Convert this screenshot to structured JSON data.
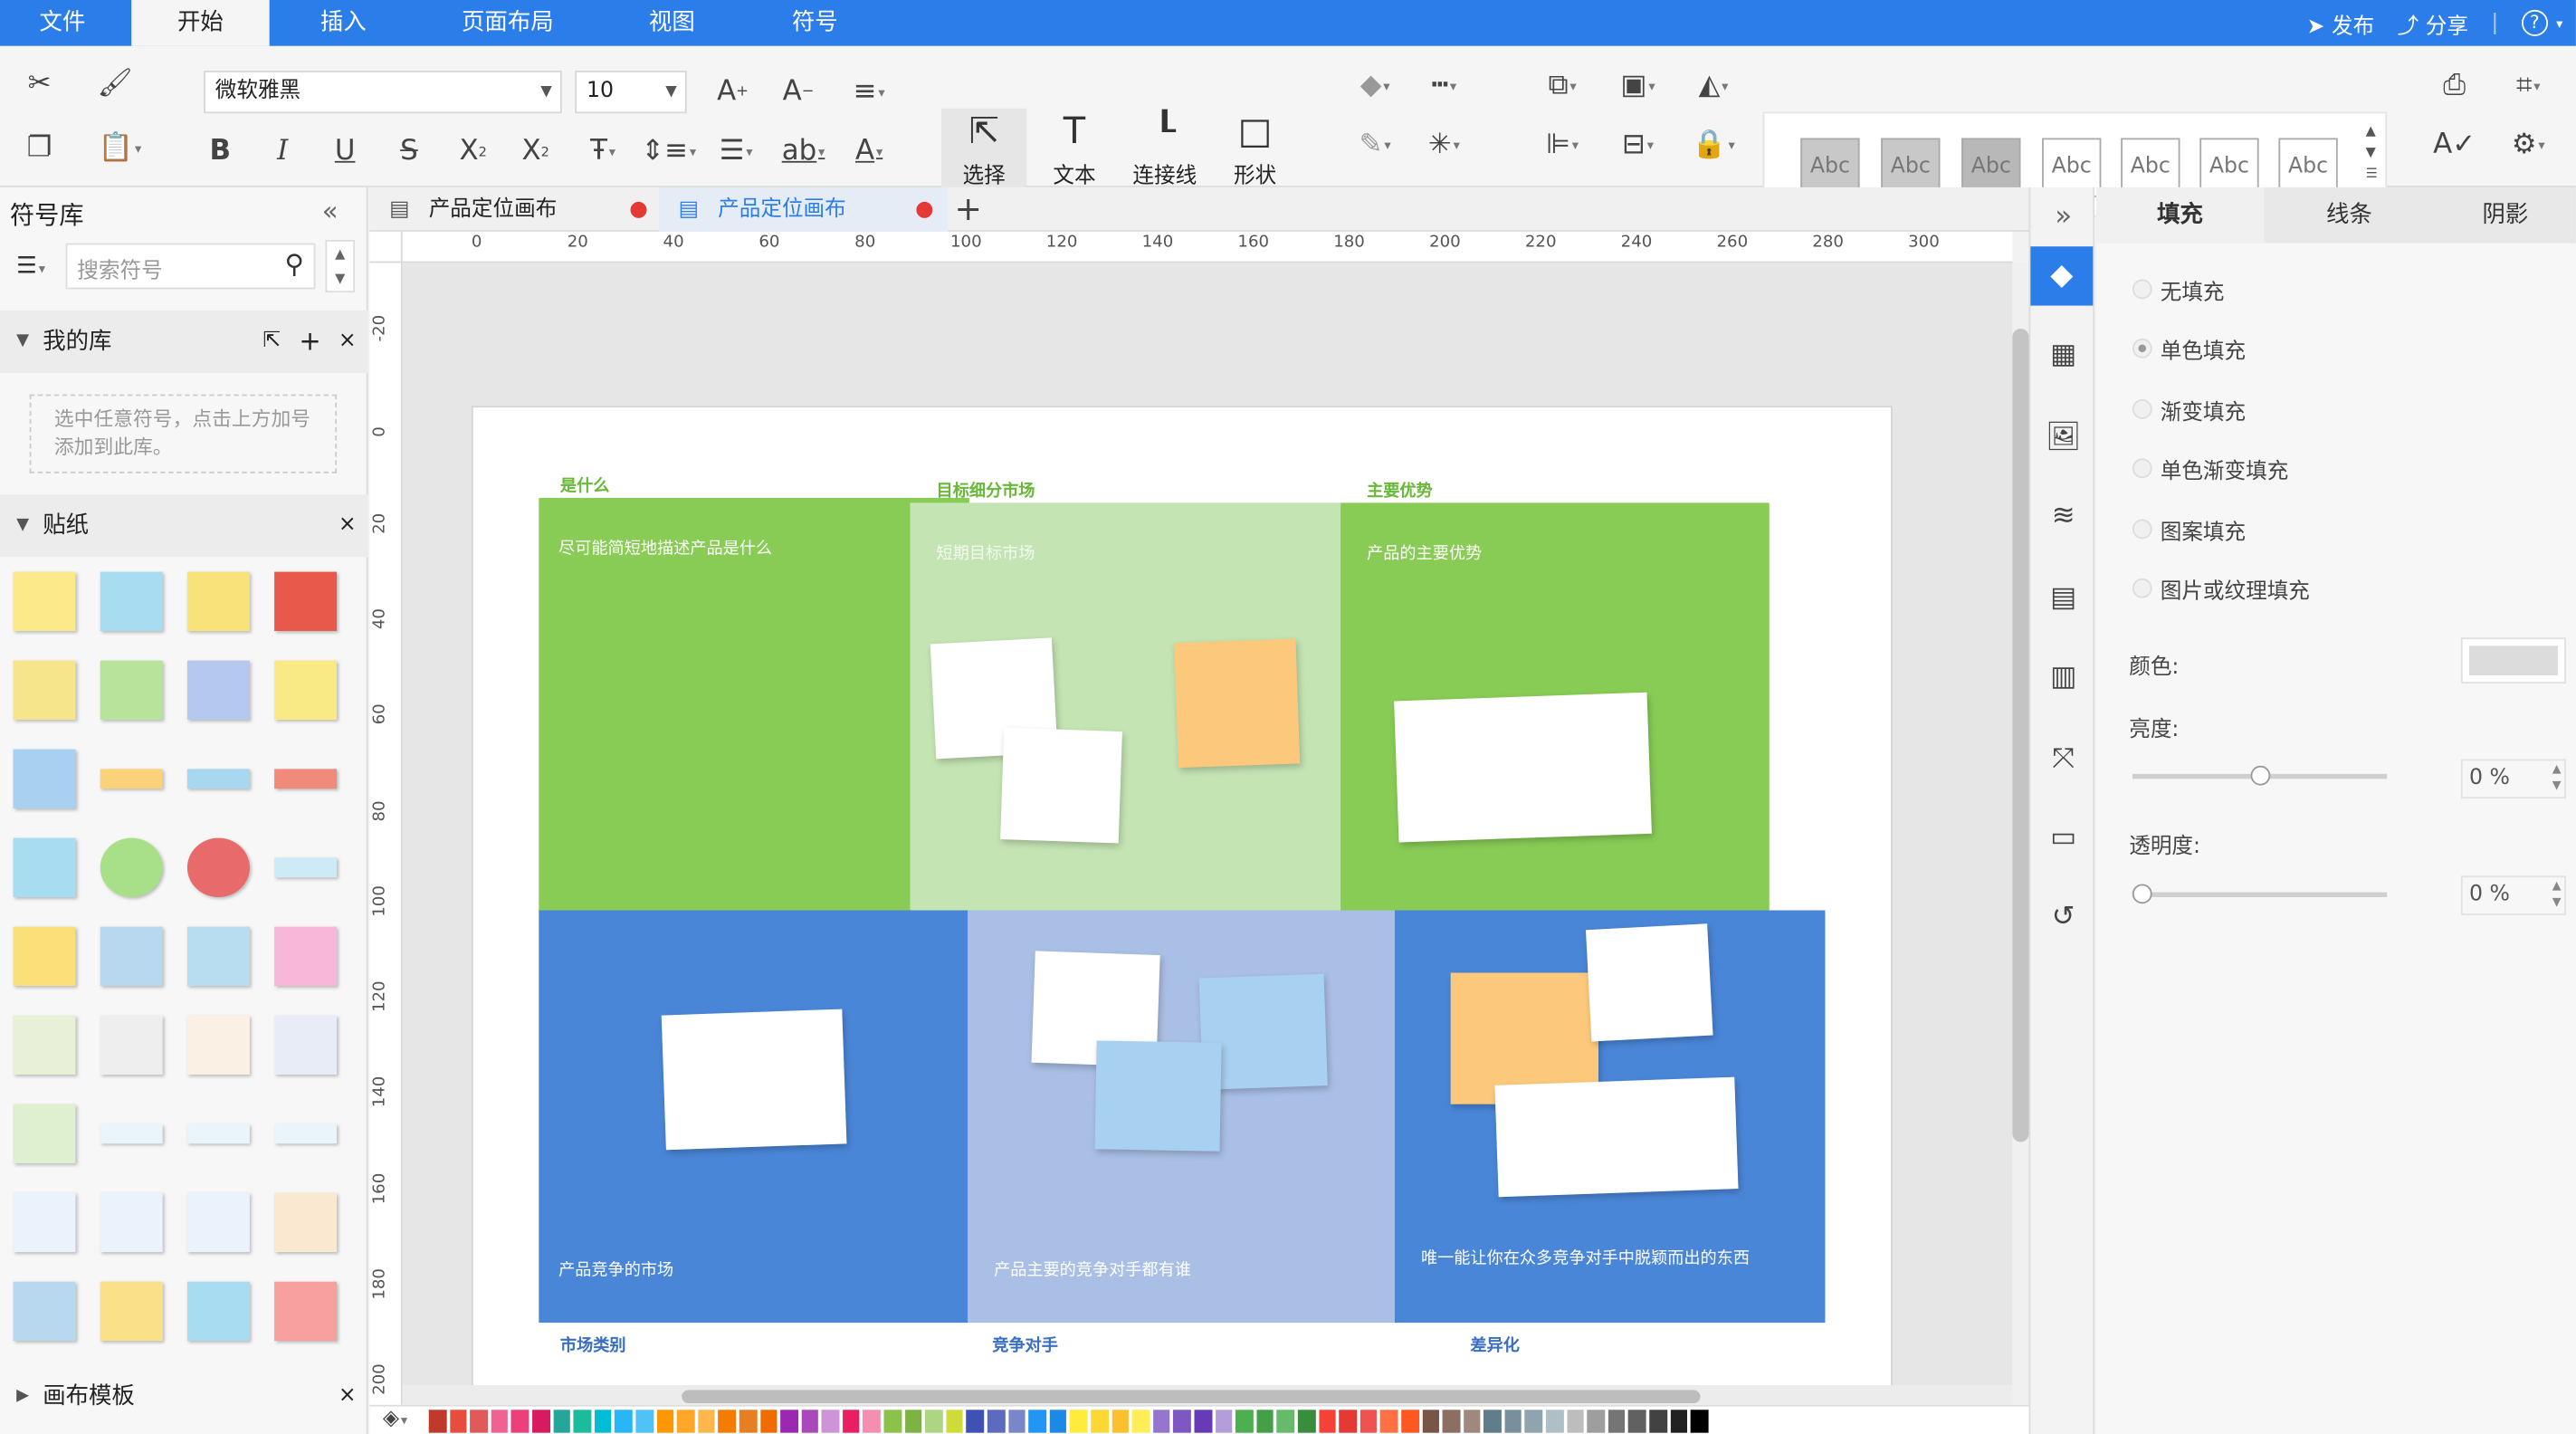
{
  "menu": {
    "items": [
      "文件",
      "开始",
      "插入",
      "页面布局",
      "视图",
      "符号"
    ],
    "active": "开始",
    "publish": "发布",
    "share": "分享",
    "help": "?"
  },
  "toolbar": {
    "font_name": "微软雅黑",
    "font_size": "10",
    "select_label": "选择",
    "text_label": "文本",
    "connector_label": "连接线",
    "shape_label": "形状",
    "style_samples": [
      "Abc",
      "Abc",
      "Abc",
      "Abc",
      "Abc",
      "Abc",
      "Abc"
    ]
  },
  "left_panel": {
    "title": "符号库",
    "search_placeholder": "搜索符号",
    "my_library": "我的库",
    "my_library_hint": "选中任意符号，点击上方加号添加到此库。",
    "stickers_title": "贴纸",
    "templates_title": "画布模板"
  },
  "tabs": [
    {
      "label": "产品定位画布",
      "active": false
    },
    {
      "label": "产品定位画布",
      "active": true
    }
  ],
  "ruler": {
    "h_ticks": [
      "0",
      "20",
      "40",
      "60",
      "80",
      "100",
      "120",
      "140",
      "160",
      "180",
      "200",
      "220",
      "240",
      "260",
      "280",
      "300"
    ],
    "v_ticks": [
      "-20",
      "0",
      "20",
      "40",
      "60",
      "80",
      "100",
      "120",
      "140",
      "160",
      "180",
      "200"
    ]
  },
  "canvas": {
    "top_labels": [
      "是什么",
      "目标细分市场",
      "主要优势"
    ],
    "bottom_labels": [
      "市场类别",
      "竞争对手",
      "差异化"
    ],
    "cells": [
      {
        "text": "尽可能简短地描述产品是什么"
      },
      {
        "text": "短期目标市场"
      },
      {
        "text": "产品的主要优势"
      },
      {
        "text": "产品竞争的市场"
      },
      {
        "text": "产品主要的竞争对手都有谁"
      },
      {
        "text": "唯一能让你在众多竞争对手中脱颖而出的东西"
      }
    ],
    "colors": {
      "green": "#88cc56",
      "light_green": "#c4e4b3",
      "blue": "#4a86d8",
      "light_blue": "#aabfe6",
      "orange_note": "#fcc97c",
      "blue_note": "#a8d0f0"
    }
  },
  "right_panel": {
    "tabs": [
      "填充",
      "线条",
      "阴影"
    ],
    "active_tab": "填充",
    "options": [
      "无填充",
      "单色填充",
      "渐变填充",
      "单色渐变填充",
      "图案填充",
      "图片或纹理填充"
    ],
    "selected_option": "单色填充",
    "color_label": "颜色:",
    "brightness_label": "亮度:",
    "brightness_value": "0 %",
    "transparency_label": "透明度:",
    "transparency_value": "0 %"
  },
  "palette": [
    "#c0392b",
    "#e74c3c",
    "#e05a5a",
    "#f06292",
    "#ec407a",
    "#d81b60",
    "#26a69a",
    "#1abc9c",
    "#00bcd4",
    "#29b6f6",
    "#4fc3f7",
    "#ff9800",
    "#ffa726",
    "#ffb74d",
    "#f57c00",
    "#e67e22",
    "#ef6c00",
    "#9c27b0",
    "#ab47bc",
    "#ce93d8",
    "#e91e63",
    "#f48fb1",
    "#8bc34a",
    "#7cb342",
    "#aed581",
    "#cddc39",
    "#3f51b5",
    "#5c6bc0",
    "#7986cb",
    "#2196f3",
    "#1e88e5",
    "#ffeb3b",
    "#fdd835",
    "#fbc02d",
    "#ffee58",
    "#9575cd",
    "#7e57c2",
    "#673ab7",
    "#b39ddb",
    "#4caf50",
    "#43a047",
    "#66bb6a",
    "#388e3c",
    "#f44336",
    "#e53935",
    "#ef5350",
    "#ff7043",
    "#ff5722",
    "#795548",
    "#8d6e63",
    "#a1887f",
    "#607d8b",
    "#78909c",
    "#90a4ae",
    "#b0bec5",
    "#bdbdbd",
    "#9e9e9e",
    "#757575",
    "#616161",
    "#424242",
    "#212121",
    "#000000",
    "#ffffff"
  ]
}
